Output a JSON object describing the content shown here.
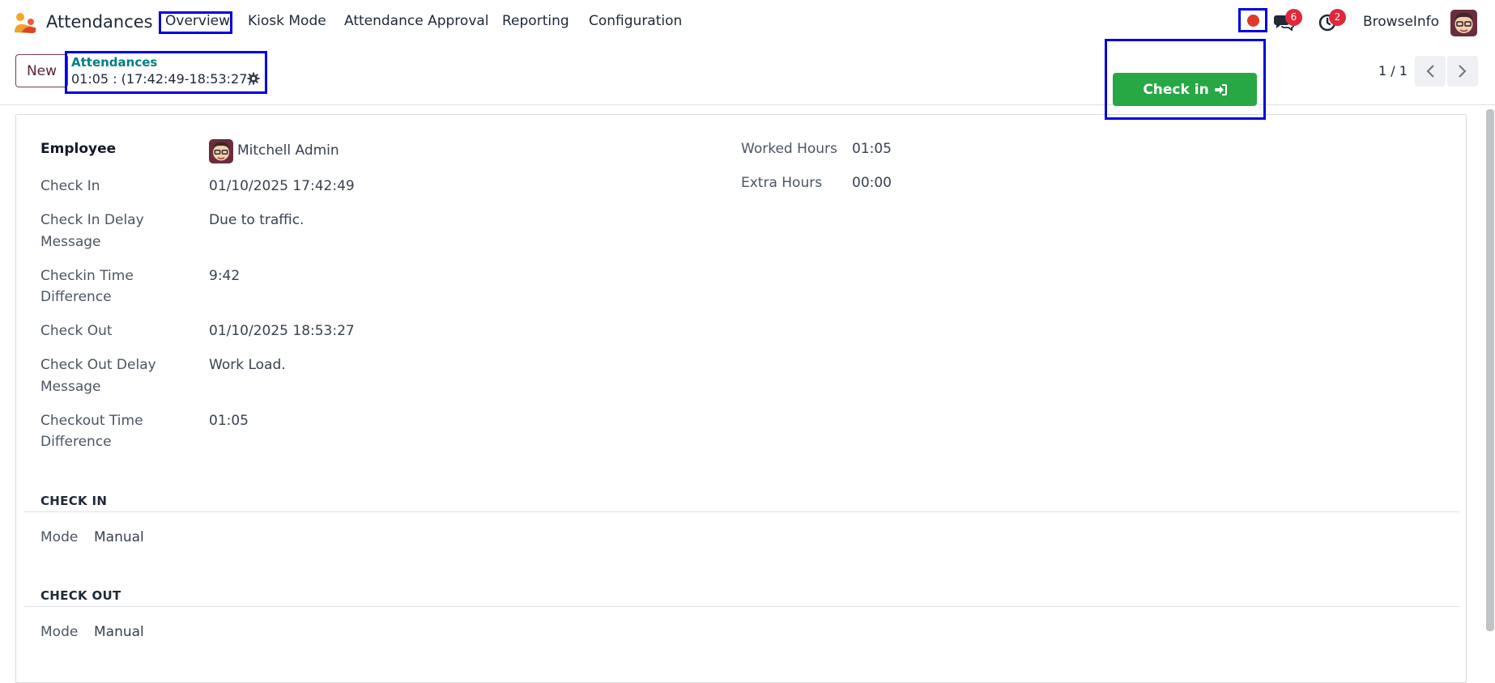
{
  "navbar": {
    "app_name": "Attendances",
    "menus": [
      "Overview",
      "Kiosk Mode",
      "Attendance Approval",
      "Reporting",
      "Configuration"
    ],
    "chat_count": "6",
    "activity_count": "2",
    "user_name": "BrowseInfo"
  },
  "control": {
    "new_label": "New",
    "breadcrumb_parent": "Attendances",
    "breadcrumb_current": "01:05 : (17:42:49-18:53:27)",
    "pager": "1 / 1",
    "checkin_label": "Check in"
  },
  "form": {
    "employee_label": "Employee",
    "employee_value": "Mitchell Admin",
    "check_in_label": "Check In",
    "check_in_value": "01/10/2025 17:42:49",
    "check_in_delay_label_1": "Check In Delay",
    "check_in_delay_label_2": "Message",
    "check_in_delay_value": "Due to traffic.",
    "checkin_diff_label_1": "Checkin Time",
    "checkin_diff_label_2": "Difference",
    "checkin_diff_value": "9:42",
    "check_out_label": "Check Out",
    "check_out_value": "01/10/2025 18:53:27",
    "check_out_delay_label_1": "Check Out Delay",
    "check_out_delay_label_2": "Message",
    "check_out_delay_value": "Work Load.",
    "checkout_diff_label_1": "Checkout Time",
    "checkout_diff_label_2": "Difference",
    "checkout_diff_value": "01:05",
    "worked_hours_label": "Worked Hours",
    "worked_hours_value": "01:05",
    "extra_hours_label": "Extra Hours",
    "extra_hours_value": "00:00",
    "check_in_section": "CHECK IN",
    "check_in_mode_label": "Mode",
    "check_in_mode_value": "Manual",
    "check_out_section": "CHECK OUT",
    "check_out_mode_label": "Mode",
    "check_out_mode_value": "Manual"
  },
  "colors": {
    "highlight_box": "#0000e0",
    "checkin_button": "#28a745",
    "breadcrumb_link": "#017e84",
    "recording_dot": "#dc3b2a",
    "badge": "#e0283a"
  },
  "icons": [
    "app-logo-icon",
    "chat-icon",
    "clock-icon",
    "gear-icon",
    "chevron-left-icon",
    "chevron-right-icon",
    "sign-in-icon",
    "user-avatar"
  ]
}
